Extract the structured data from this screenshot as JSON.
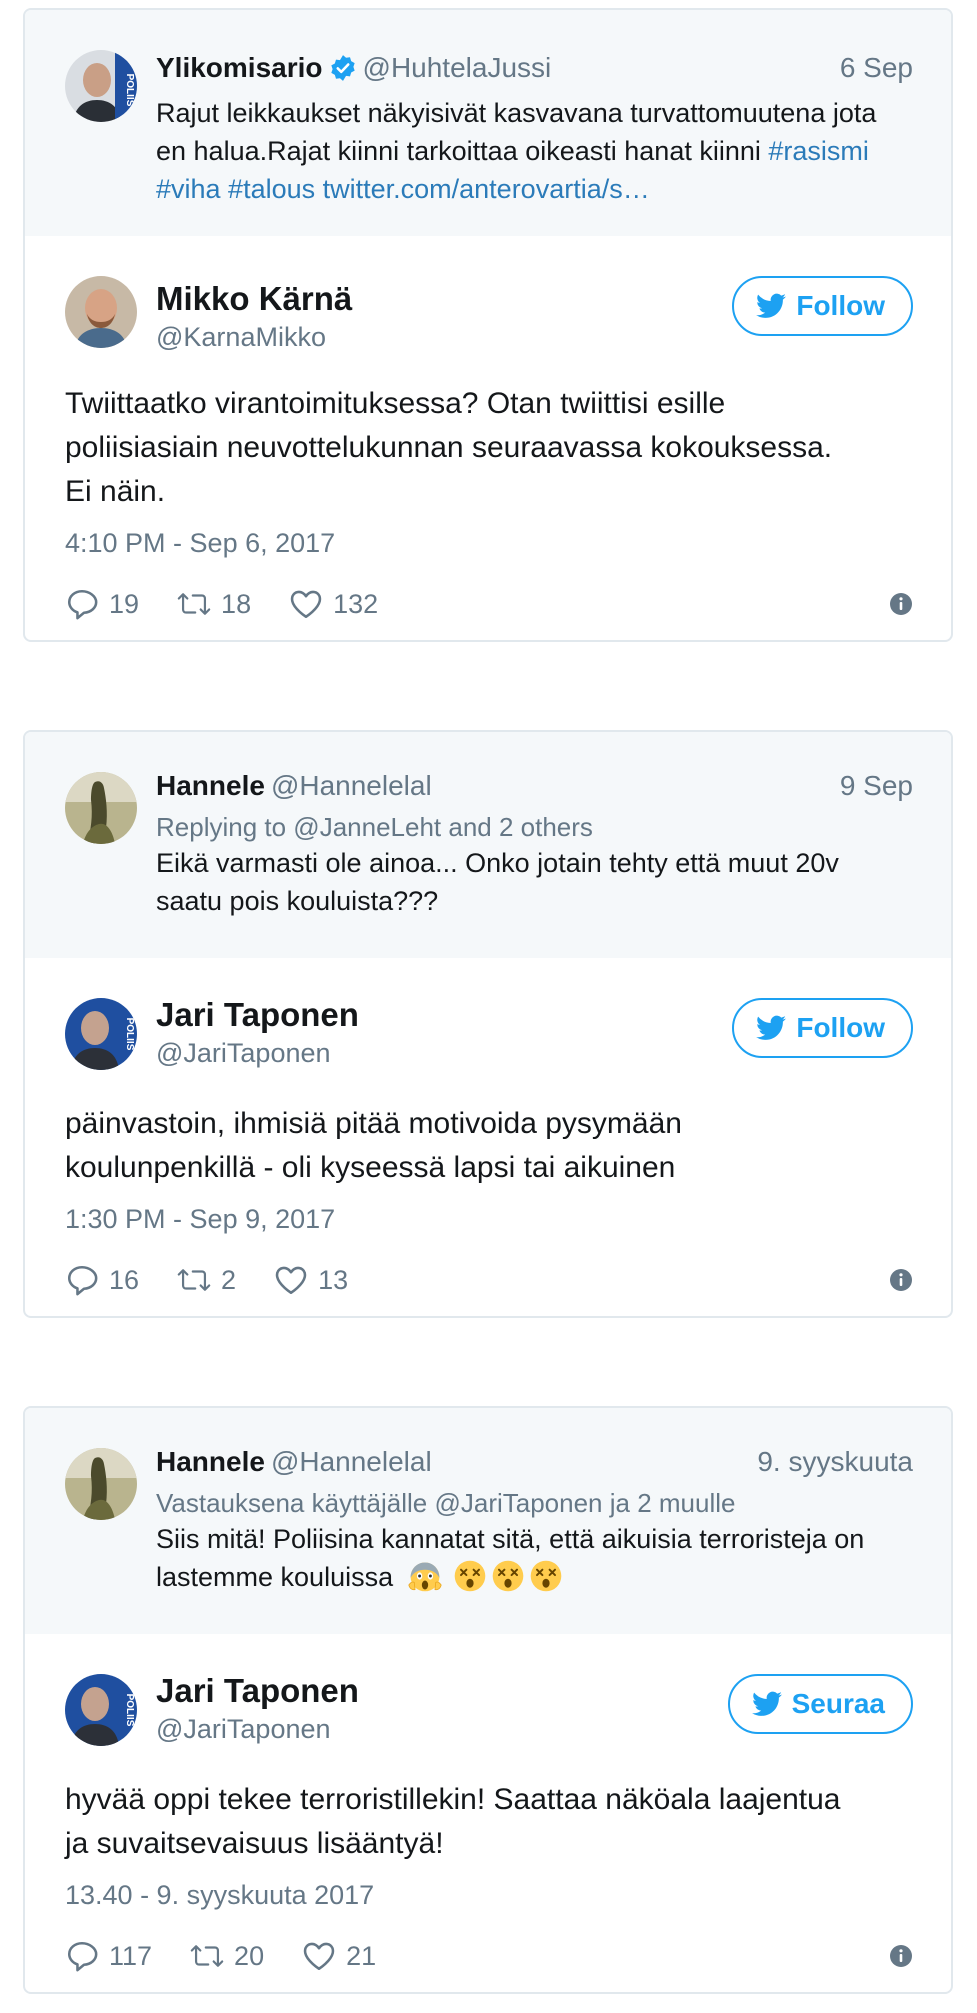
{
  "tweets": [
    {
      "quoted": {
        "name": "Ylikomisario",
        "handle": "@HuhtelaJussi",
        "date": "6 Sep",
        "reply_to": "",
        "text_line1": "Rajut leikkaukset näkyisivät kasvavana turvattomuutena jota",
        "text_line2_plain": "en halua.Rajat kiinni tarkoittaa oikeasti hanat kiinni ",
        "text_line2_link": "#rasismi",
        "text_line3_link": "#viha #talous twitter.com/anterovartia/s…",
        "verified": true
      },
      "main": {
        "name": "Mikko Kärnä",
        "handle": "@KarnaMikko",
        "follow_label": "Follow",
        "text_line1": "Twiittaatko virantoimituksessa? Otan twiittisi esille",
        "text_line2": "poliisiasiain neuvottelukunnan seuraavassa kokouksessa.",
        "text_line3": "Ei näin.",
        "timestamp": "4:10 PM - Sep 6, 2017",
        "replies": "19",
        "retweets": "18",
        "likes": "132"
      }
    },
    {
      "quoted": {
        "name": "Hannele",
        "handle": "@Hannelelal",
        "date": "9 Sep",
        "reply_to": "Replying to @JanneLeht and 2 others",
        "text_line1": "Eikä varmasti ole ainoa... Onko jotain tehty että muut 20v",
        "text_line2": "saatu pois kouluista???"
      },
      "main": {
        "name": "Jari Taponen",
        "handle": "@JariTaponen",
        "follow_label": "Follow",
        "text_line1": "päinvastoin, ihmisiä pitää motivoida pysymään",
        "text_line2": "koulunpenkillä - oli kyseessä lapsi tai aikuinen",
        "timestamp": "1:30 PM - Sep 9, 2017",
        "replies": "16",
        "retweets": "2",
        "likes": "13"
      }
    },
    {
      "quoted": {
        "name": "Hannele",
        "handle": "@Hannelelal",
        "date": "9. syyskuuta",
        "reply_to": "Vastauksena käyttäjälle @JariTaponen ja 2 muulle",
        "text_line1": "Siis mitä! Poliisina kannatat sitä, että aikuisia terroristeja on",
        "text_line2": "lastemme kouluissa"
      },
      "main": {
        "name": "Jari Taponen",
        "handle": "@JariTaponen",
        "follow_label": "Seuraa",
        "text_line1": "hyvää oppi tekee terroristillekin! Saattaa näköala laajentua",
        "text_line2": "ja suvaitsevaisuus lisääntyä!",
        "timestamp": "13.40 - 9. syyskuuta 2017",
        "replies": "117",
        "retweets": "20",
        "likes": "21"
      }
    }
  ],
  "colors": {
    "accent": "#1da1f2",
    "link": "#2b7bb9",
    "muted": "#657786",
    "quoted_bg": "#f5f8fa",
    "border": "#e1e8ed"
  },
  "icons": [
    "verified-badge-icon",
    "twitter-bird-icon",
    "reply-icon",
    "retweet-icon",
    "like-heart-icon",
    "info-icon",
    "scream-emoji-icon",
    "dizzy-face-emoji-icon"
  ]
}
